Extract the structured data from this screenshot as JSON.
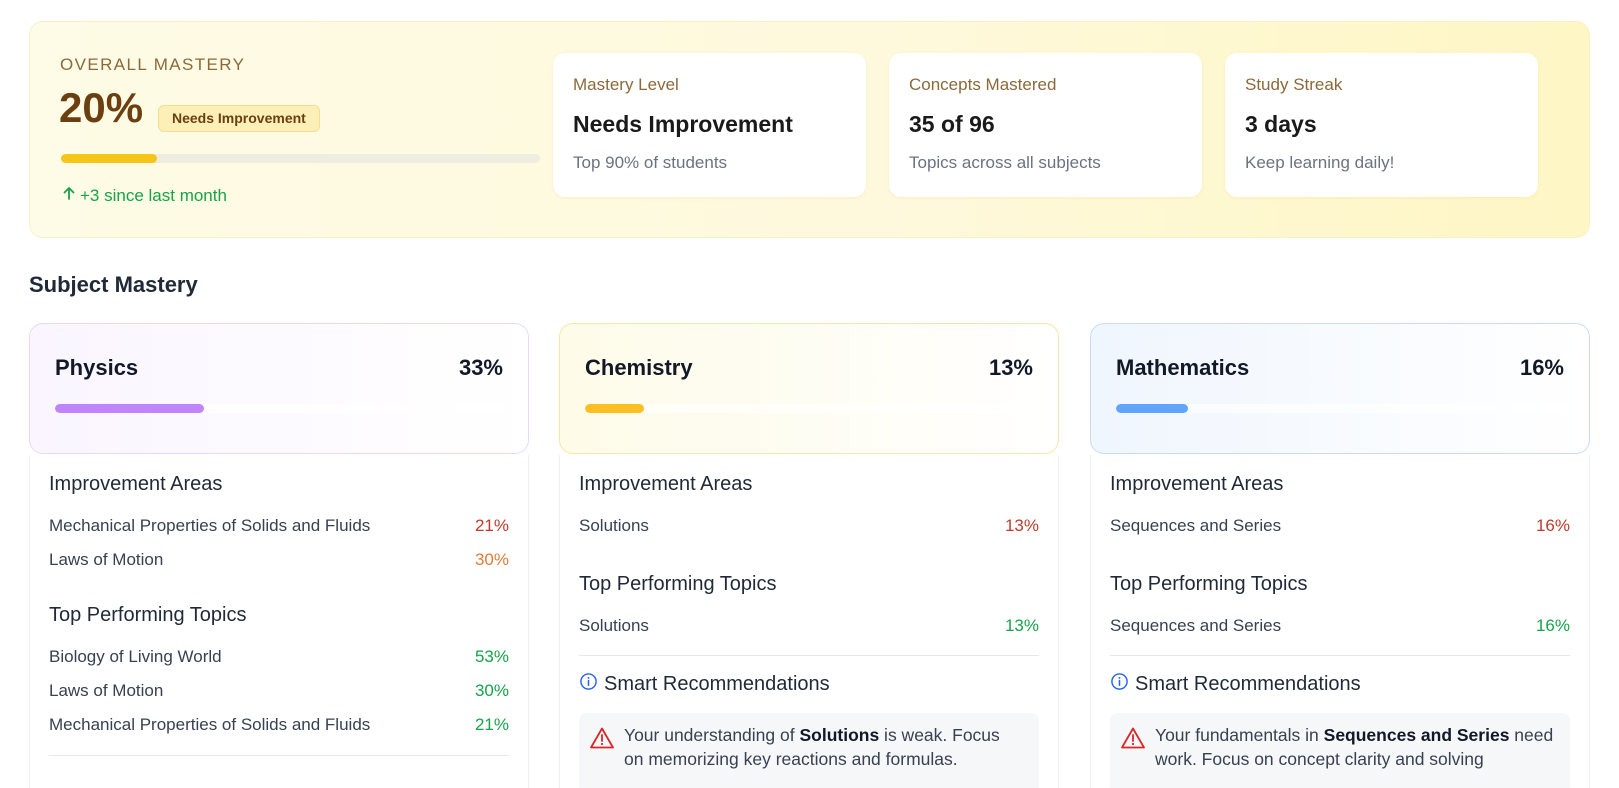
{
  "overall": {
    "label": "OVERALL MASTERY",
    "percent": "20%",
    "progress_fraction": 0.2,
    "badge": "Needs Improvement",
    "change": "+3 since last month",
    "stats": [
      {
        "title": "Mastery Level",
        "value": "Needs Improvement",
        "sub": "Top 90% of students"
      },
      {
        "title": "Concepts Mastered",
        "value": "35 of 96",
        "sub": "Topics across all subjects"
      },
      {
        "title": "Study Streak",
        "value": "3 days",
        "sub": "Keep learning daily!"
      }
    ]
  },
  "subject_mastery": {
    "title": "Subject Mastery",
    "subjects": [
      {
        "name": "Physics",
        "percent": "33%",
        "progress_fraction": 0.33,
        "accent": "#c084fc",
        "head_bg": "#faf5ff",
        "head_border": "#e9d8fd",
        "improvement_title": "Improvement Areas",
        "improvement": [
          {
            "topic": "Mechanical Properties of Solids and Fluids",
            "value": "21%",
            "color": "#c0392b"
          },
          {
            "topic": "Laws of Motion",
            "value": "30%",
            "color": "#e07b39"
          }
        ],
        "top_title": "Top Performing Topics",
        "top": [
          {
            "topic": "Biology of Living World",
            "value": "53%",
            "color": "#16a34a"
          },
          {
            "topic": "Laws of Motion",
            "value": "30%",
            "color": "#16a34a"
          },
          {
            "topic": "Mechanical Properties of Solids and Fluids",
            "value": "21%",
            "color": "#16a34a"
          }
        ]
      },
      {
        "name": "Chemistry",
        "percent": "13%",
        "progress_fraction": 0.13,
        "accent": "#fbbf24",
        "head_bg": "#fefbe8",
        "head_border": "#f8e6a8",
        "improvement_title": "Improvement Areas",
        "improvement": [
          {
            "topic": "Solutions",
            "value": "13%",
            "color": "#c0392b"
          }
        ],
        "top_title": "Top Performing Topics",
        "top": [
          {
            "topic": "Solutions",
            "value": "13%",
            "color": "#16a34a"
          }
        ],
        "recommendations_title": "Smart Recommendations",
        "recommendation": {
          "prefix": "Your understanding of ",
          "bold": "Solutions",
          "suffix": " is weak. Focus on memorizing key reactions and formulas."
        }
      },
      {
        "name": "Mathematics",
        "percent": "16%",
        "progress_fraction": 0.16,
        "accent": "#60a5fa",
        "head_bg": "#f0f6fe",
        "head_border": "#c9dcf7",
        "improvement_title": "Improvement Areas",
        "improvement": [
          {
            "topic": "Sequences and Series",
            "value": "16%",
            "color": "#c0392b"
          }
        ],
        "top_title": "Top Performing Topics",
        "top": [
          {
            "topic": "Sequences and Series",
            "value": "16%",
            "color": "#16a34a"
          }
        ],
        "recommendations_title": "Smart Recommendations",
        "recommendation": {
          "prefix": "Your fundamentals in ",
          "bold": "Sequences and Series",
          "suffix": " need work. Focus on concept clarity and solving"
        }
      }
    ]
  },
  "icons": {
    "change": "arrow-up-icon",
    "recommendations": "info-circle-icon",
    "recommendation_item": "warning-triangle-icon"
  },
  "colors": {
    "progress_overall": "#f5c518",
    "increase": "#16a34a"
  }
}
